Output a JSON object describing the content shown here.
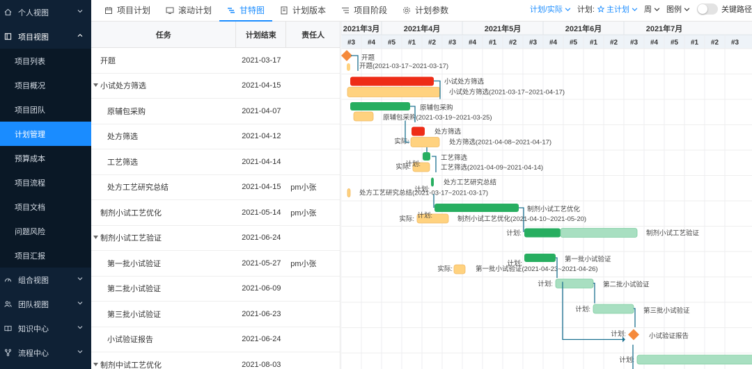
{
  "sidebar": {
    "top_items": [
      {
        "label": "个人视图",
        "icon": "home-icon"
      },
      {
        "label": "项目视图",
        "icon": "project-board-icon"
      }
    ],
    "sub_items": [
      "项目列表",
      "项目概况",
      "项目团队",
      "计划管理",
      "预算成本",
      "项目流程",
      "项目文档",
      "问题风险",
      "项目汇报"
    ],
    "active_sub": 3,
    "bottom_items": [
      {
        "label": "组合视图",
        "icon": "dashboard-icon"
      },
      {
        "label": "团队视图",
        "icon": "team-icon"
      },
      {
        "label": "知识中心",
        "icon": "book-icon"
      },
      {
        "label": "流程中心",
        "icon": "flow-icon"
      }
    ]
  },
  "tabs": [
    {
      "label": "项目计划",
      "icon": "calendar-icon"
    },
    {
      "label": "滚动计划",
      "icon": "monitor-icon"
    },
    {
      "label": "甘特图",
      "icon": "gantt-icon"
    },
    {
      "label": "计划版本",
      "icon": "version-icon"
    },
    {
      "label": "项目阶段",
      "icon": "stage-icon"
    },
    {
      "label": "计划参数",
      "icon": "settings-icon"
    }
  ],
  "active_tab": 2,
  "toolbar": {
    "mode": "计划/实际",
    "plan_label": "计划:",
    "plan_value": "主计划",
    "period": "周",
    "legend": "图例",
    "critical_path": "关键路径"
  },
  "table": {
    "headers": [
      "任务",
      "计划结束",
      "责任人"
    ],
    "rows": [
      {
        "task": "开题",
        "end": "2021-03-17",
        "owner": "",
        "level": 0,
        "group": false
      },
      {
        "task": "小试处方筛选",
        "end": "2021-04-15",
        "owner": "",
        "level": 0,
        "group": true
      },
      {
        "task": "原辅包采购",
        "end": "2021-04-07",
        "owner": "",
        "level": 1,
        "group": false
      },
      {
        "task": "处方筛选",
        "end": "2021-04-12",
        "owner": "",
        "level": 1,
        "group": false
      },
      {
        "task": "工艺筛选",
        "end": "2021-04-14",
        "owner": "",
        "level": 1,
        "group": false
      },
      {
        "task": "处方工艺研究总结",
        "end": "2021-04-15",
        "owner": "pm小张",
        "level": 1,
        "group": false
      },
      {
        "task": "制剂小试工艺优化",
        "end": "2021-05-14",
        "owner": "pm小张",
        "level": 0,
        "group": false
      },
      {
        "task": "制剂小试工艺验证",
        "end": "2021-06-24",
        "owner": "",
        "level": 0,
        "group": true
      },
      {
        "task": "第一批小试验证",
        "end": "2021-05-27",
        "owner": "pm小张",
        "level": 1,
        "group": false
      },
      {
        "task": "第二批小试验证",
        "end": "2021-06-09",
        "owner": "",
        "level": 1,
        "group": false
      },
      {
        "task": "第三批小试验证",
        "end": "2021-06-23",
        "owner": "",
        "level": 1,
        "group": false
      },
      {
        "task": "小试验证报告",
        "end": "2021-06-24",
        "owner": "",
        "level": 1,
        "group": false
      },
      {
        "task": "制剂中试工艺优化",
        "end": "2021-08-03",
        "owner": "",
        "level": 0,
        "group": true
      }
    ]
  },
  "gantt": {
    "months": [
      "2021年3月",
      "2021年4月",
      "2021年5月",
      "2021年6月",
      "2021年7月"
    ],
    "month_week_counts": [
      2,
      4,
      4,
      4,
      4
    ],
    "weeks": [
      "#3",
      "#4",
      "#5",
      "#1",
      "#2",
      "#3",
      "#4",
      "#1",
      "#2",
      "#3",
      "#4",
      "#5",
      "#1",
      "#2",
      "#3",
      "#4",
      "#5",
      "#1",
      "#2",
      "#3"
    ],
    "labels": {
      "plan": "计划:",
      "actual": "实际:"
    },
    "colors": {
      "plan_green": "#27ae60",
      "plan_light": "#a8dfc1",
      "actual_orange": "#ffd27f",
      "delay_red": "#ee2c17",
      "milestone": "#f5893b",
      "link": "#1a6f8f"
    },
    "bar_labels": [
      "开题",
      "开题(2021-03-17~2021-03-17)",
      "小试处方筛选",
      "小试处方筛选(2021-03-17~2021-04-17)",
      "原辅包采购",
      "原辅包采购(2021-03-19~2021-03-25)",
      "处方筛选",
      "处方筛选(2021-04-08~2021-04-17)",
      "工艺筛选",
      "工艺筛选(2021-04-09~2021-04-14)",
      "处方工艺研究总结",
      "处方工艺研究总结(2021-03-17~2021-03-17)",
      "制剂小试工艺优化",
      "制剂小试工艺优化(2021-04-10~2021-05-20)",
      "制剂小试工艺验证",
      "第一批小试验证",
      "第一批小试验证(2021-04-23~2021-04-26)",
      "第二批小试验证",
      "第三批小试验证",
      "小试验证报告"
    ]
  }
}
